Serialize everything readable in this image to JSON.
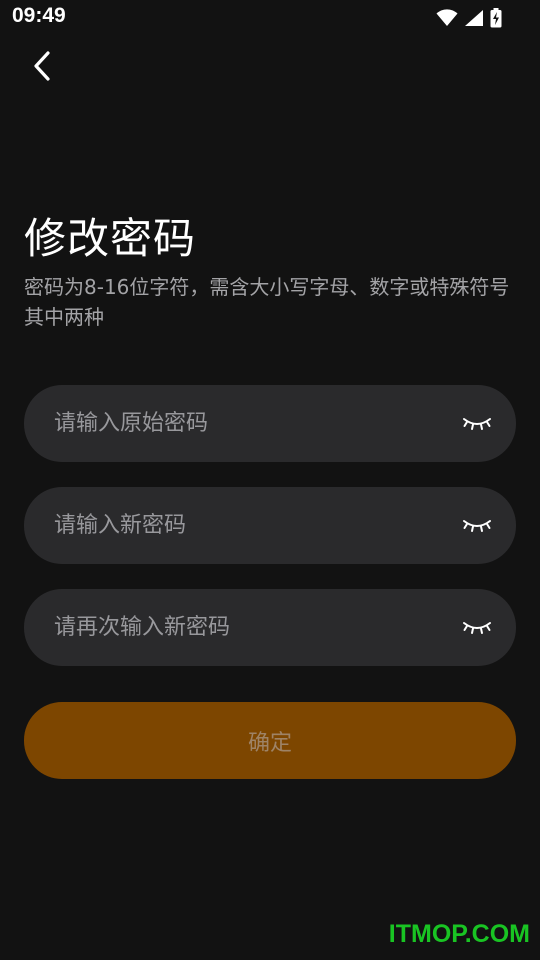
{
  "status_bar": {
    "time": "09:49"
  },
  "header": {
    "back_icon": "chevron-left-icon"
  },
  "page": {
    "title": "修改密码",
    "subtitle": "密码为8-16位字符，需含大小写字母、数字或特殊符号其中两种"
  },
  "form": {
    "fields": [
      {
        "placeholder": "请输入原始密码",
        "value": "",
        "toggle_icon": "eye-closed-icon"
      },
      {
        "placeholder": "请输入新密码",
        "value": "",
        "toggle_icon": "eye-closed-icon"
      },
      {
        "placeholder": "请再次输入新密码",
        "value": "",
        "toggle_icon": "eye-closed-icon"
      }
    ],
    "confirm_label": "确定"
  },
  "watermark": "ITMOP.COM",
  "colors": {
    "background": "#121212",
    "field_background": "#2a2a2c",
    "confirm_background": "#7d4600",
    "confirm_text": "#9e8366",
    "watermark": "#19c423"
  }
}
